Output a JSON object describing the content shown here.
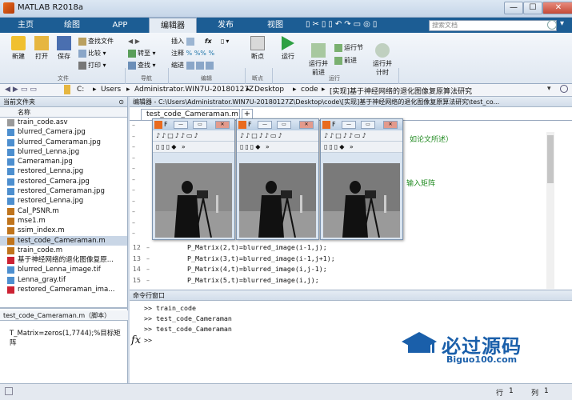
{
  "window": {
    "title": "MATLAB R2018a",
    "min": "—",
    "max": "☐",
    "close": "✕"
  },
  "tabs": [
    "主页",
    "绘图",
    "APP",
    "编辑器",
    "发布",
    "视图"
  ],
  "search": {
    "placeholder": "搜索文档"
  },
  "ribbon": {
    "new": "新建",
    "open": "打开",
    "save": "保存",
    "find_files": "查找文件",
    "compare": "比较",
    "print": "打印",
    "goto": "转至",
    "find": "查找",
    "insert": "插入",
    "fx": "fx",
    "comment": "注释",
    "indent": "缩进",
    "breakpoints": "断点",
    "run": "运行",
    "run_advance": "运行并\n前进",
    "run_section": "运行节",
    "advance": "前进",
    "run_time": "运行并\n计时",
    "groups": [
      "文件",
      "导航",
      "编辑",
      "断点",
      "运行"
    ]
  },
  "address": {
    "parts": [
      "C:",
      "Users",
      "Administrator.WIN7U-20180127Z",
      "Desktop",
      "code",
      "[实现]基于神经网络的退化图像复原算法研究"
    ]
  },
  "left": {
    "header": "当前文件夹",
    "col_name": "名称",
    "files": [
      "train_code.asv",
      "blurred_Camera.jpg",
      "blurred_Cameraman.jpg",
      "blurred_Lenna.jpg",
      "Cameraman.jpg",
      "restored_Lenna.jpg",
      "restored_Camera.jpg",
      "restored_Cameraman.jpg",
      "restored_Lenna.jpg",
      "Cal_PSNR.m",
      "mse1.m",
      "ssim_index.m",
      "test_code_Cameraman.m",
      "train_code.m",
      "基于神经网络的退化图像复原...",
      "blurred_Lenna_image.tif",
      "Lenna_gray.tif",
      "restored_Cameraman_ima..."
    ],
    "selected_index": 12,
    "detail_title": "test_code_Cameraman.m（脚本）",
    "detail_text": "T_Matrix=zeros(1,7744);%目标矩阵"
  },
  "editor": {
    "header": "编辑器 - C:\\Users\\Administrator.WIN7U-20180127Z\\Desktop\\code\\[实现]基于神经网络的退化图像复原算法研究\\test_co...",
    "tab": "test_code_Cameraman.m",
    "add": "+",
    "side_text1": "如论文所述）",
    "side_text2": "输入矩阵",
    "lines": [
      {
        "n": "12",
        "code": "        P_Matrix(2,t)=blurred_image(i-1,j);"
      },
      {
        "n": "13",
        "code": "        P_Matrix(3,t)=blurred_image(i-1,j+1);"
      },
      {
        "n": "14",
        "code": "        P_Matrix(4,t)=blurred_image(i,j-1);"
      },
      {
        "n": "15",
        "code": "        P_Matrix(5,t)=blurred_image(i,j);"
      }
    ],
    "dashes": [
      "–",
      "–",
      "–",
      "–",
      "–",
      "–",
      "–",
      "–",
      "–",
      "–",
      "–"
    ]
  },
  "figures": {
    "title": "F",
    "toolbar1": "♪♪□♪♪▭♪",
    "toolbar2": "▯▯▯◆ »"
  },
  "cmd": {
    "header": "命令行窗口",
    "lines": [
      ">> train_code",
      ">> test_code_Cameraman",
      ">> test_code_Cameraman"
    ],
    "prompt": ">>",
    "fx": "fx"
  },
  "status": {
    "row_label": "行",
    "row": "1",
    "col_label": "列",
    "col": "1"
  },
  "watermark": {
    "big": "必过源码",
    "small": "Biguo100.com"
  }
}
